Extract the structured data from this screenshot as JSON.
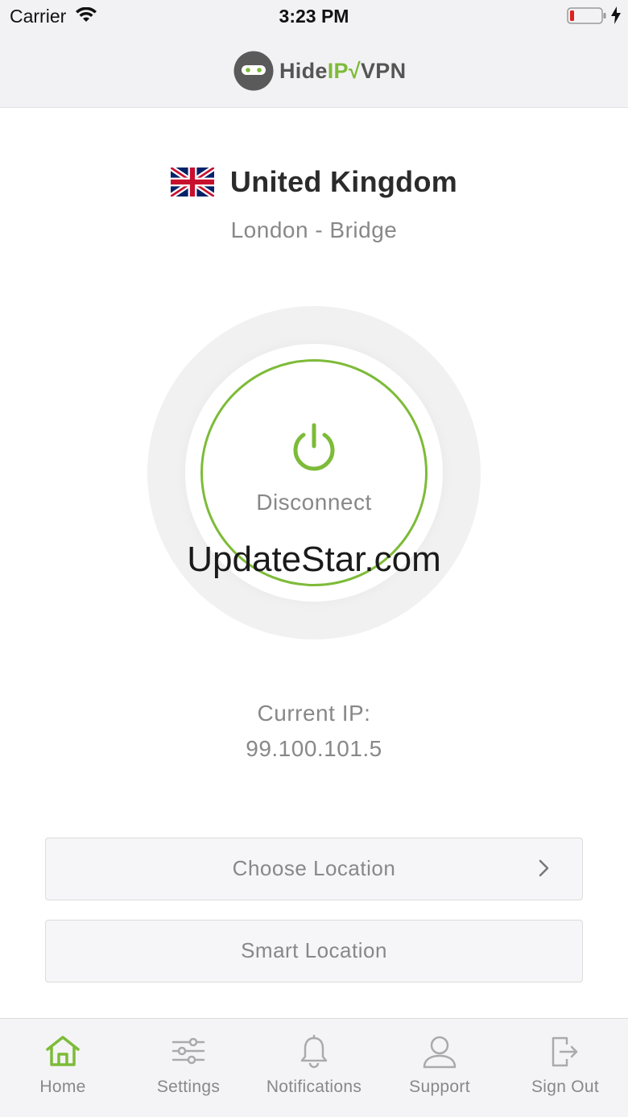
{
  "status_bar": {
    "carrier": "Carrier",
    "time": "3:23 PM"
  },
  "header": {
    "logo_prefix": "Hide",
    "logo_ip": "IP",
    "logo_suffix": "VPN",
    "logo_check": "√"
  },
  "location": {
    "country": "United Kingdom",
    "city": "London - Bridge",
    "flag_icon": "uk-flag-icon"
  },
  "connection": {
    "button_label": "Disconnect",
    "power_icon": "power-icon",
    "accent_color": "#7dbb38"
  },
  "watermark": "UpdateStar.com",
  "ip": {
    "label": "Current IP:",
    "value": "99.100.101.5"
  },
  "actions": {
    "choose_location": "Choose Location",
    "smart_location": "Smart Location"
  },
  "tabs": [
    {
      "label": "Home",
      "icon": "home-icon",
      "active": true
    },
    {
      "label": "Settings",
      "icon": "sliders-icon",
      "active": false
    },
    {
      "label": "Notifications",
      "icon": "bell-icon",
      "active": false
    },
    {
      "label": "Support",
      "icon": "user-icon",
      "active": false
    },
    {
      "label": "Sign Out",
      "icon": "sign-out-icon",
      "active": false
    }
  ]
}
